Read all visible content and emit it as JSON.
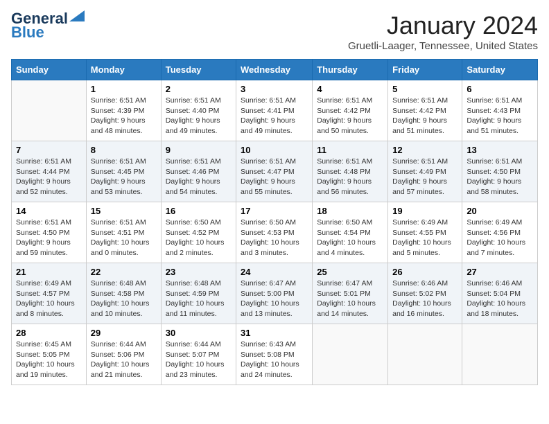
{
  "header": {
    "logo_line1": "General",
    "logo_line2": "Blue",
    "month_title": "January 2024",
    "subtitle": "Gruetli-Laager, Tennessee, United States"
  },
  "days_of_week": [
    "Sunday",
    "Monday",
    "Tuesday",
    "Wednesday",
    "Thursday",
    "Friday",
    "Saturday"
  ],
  "weeks": [
    [
      {
        "day": "",
        "info": ""
      },
      {
        "day": "1",
        "info": "Sunrise: 6:51 AM\nSunset: 4:39 PM\nDaylight: 9 hours\nand 48 minutes."
      },
      {
        "day": "2",
        "info": "Sunrise: 6:51 AM\nSunset: 4:40 PM\nDaylight: 9 hours\nand 49 minutes."
      },
      {
        "day": "3",
        "info": "Sunrise: 6:51 AM\nSunset: 4:41 PM\nDaylight: 9 hours\nand 49 minutes."
      },
      {
        "day": "4",
        "info": "Sunrise: 6:51 AM\nSunset: 4:42 PM\nDaylight: 9 hours\nand 50 minutes."
      },
      {
        "day": "5",
        "info": "Sunrise: 6:51 AM\nSunset: 4:42 PM\nDaylight: 9 hours\nand 51 minutes."
      },
      {
        "day": "6",
        "info": "Sunrise: 6:51 AM\nSunset: 4:43 PM\nDaylight: 9 hours\nand 51 minutes."
      }
    ],
    [
      {
        "day": "7",
        "info": "Sunrise: 6:51 AM\nSunset: 4:44 PM\nDaylight: 9 hours\nand 52 minutes."
      },
      {
        "day": "8",
        "info": "Sunrise: 6:51 AM\nSunset: 4:45 PM\nDaylight: 9 hours\nand 53 minutes."
      },
      {
        "day": "9",
        "info": "Sunrise: 6:51 AM\nSunset: 4:46 PM\nDaylight: 9 hours\nand 54 minutes."
      },
      {
        "day": "10",
        "info": "Sunrise: 6:51 AM\nSunset: 4:47 PM\nDaylight: 9 hours\nand 55 minutes."
      },
      {
        "day": "11",
        "info": "Sunrise: 6:51 AM\nSunset: 4:48 PM\nDaylight: 9 hours\nand 56 minutes."
      },
      {
        "day": "12",
        "info": "Sunrise: 6:51 AM\nSunset: 4:49 PM\nDaylight: 9 hours\nand 57 minutes."
      },
      {
        "day": "13",
        "info": "Sunrise: 6:51 AM\nSunset: 4:50 PM\nDaylight: 9 hours\nand 58 minutes."
      }
    ],
    [
      {
        "day": "14",
        "info": "Sunrise: 6:51 AM\nSunset: 4:50 PM\nDaylight: 9 hours\nand 59 minutes."
      },
      {
        "day": "15",
        "info": "Sunrise: 6:51 AM\nSunset: 4:51 PM\nDaylight: 10 hours\nand 0 minutes."
      },
      {
        "day": "16",
        "info": "Sunrise: 6:50 AM\nSunset: 4:52 PM\nDaylight: 10 hours\nand 2 minutes."
      },
      {
        "day": "17",
        "info": "Sunrise: 6:50 AM\nSunset: 4:53 PM\nDaylight: 10 hours\nand 3 minutes."
      },
      {
        "day": "18",
        "info": "Sunrise: 6:50 AM\nSunset: 4:54 PM\nDaylight: 10 hours\nand 4 minutes."
      },
      {
        "day": "19",
        "info": "Sunrise: 6:49 AM\nSunset: 4:55 PM\nDaylight: 10 hours\nand 5 minutes."
      },
      {
        "day": "20",
        "info": "Sunrise: 6:49 AM\nSunset: 4:56 PM\nDaylight: 10 hours\nand 7 minutes."
      }
    ],
    [
      {
        "day": "21",
        "info": "Sunrise: 6:49 AM\nSunset: 4:57 PM\nDaylight: 10 hours\nand 8 minutes."
      },
      {
        "day": "22",
        "info": "Sunrise: 6:48 AM\nSunset: 4:58 PM\nDaylight: 10 hours\nand 10 minutes."
      },
      {
        "day": "23",
        "info": "Sunrise: 6:48 AM\nSunset: 4:59 PM\nDaylight: 10 hours\nand 11 minutes."
      },
      {
        "day": "24",
        "info": "Sunrise: 6:47 AM\nSunset: 5:00 PM\nDaylight: 10 hours\nand 13 minutes."
      },
      {
        "day": "25",
        "info": "Sunrise: 6:47 AM\nSunset: 5:01 PM\nDaylight: 10 hours\nand 14 minutes."
      },
      {
        "day": "26",
        "info": "Sunrise: 6:46 AM\nSunset: 5:02 PM\nDaylight: 10 hours\nand 16 minutes."
      },
      {
        "day": "27",
        "info": "Sunrise: 6:46 AM\nSunset: 5:04 PM\nDaylight: 10 hours\nand 18 minutes."
      }
    ],
    [
      {
        "day": "28",
        "info": "Sunrise: 6:45 AM\nSunset: 5:05 PM\nDaylight: 10 hours\nand 19 minutes."
      },
      {
        "day": "29",
        "info": "Sunrise: 6:44 AM\nSunset: 5:06 PM\nDaylight: 10 hours\nand 21 minutes."
      },
      {
        "day": "30",
        "info": "Sunrise: 6:44 AM\nSunset: 5:07 PM\nDaylight: 10 hours\nand 23 minutes."
      },
      {
        "day": "31",
        "info": "Sunrise: 6:43 AM\nSunset: 5:08 PM\nDaylight: 10 hours\nand 24 minutes."
      },
      {
        "day": "",
        "info": ""
      },
      {
        "day": "",
        "info": ""
      },
      {
        "day": "",
        "info": ""
      }
    ]
  ]
}
